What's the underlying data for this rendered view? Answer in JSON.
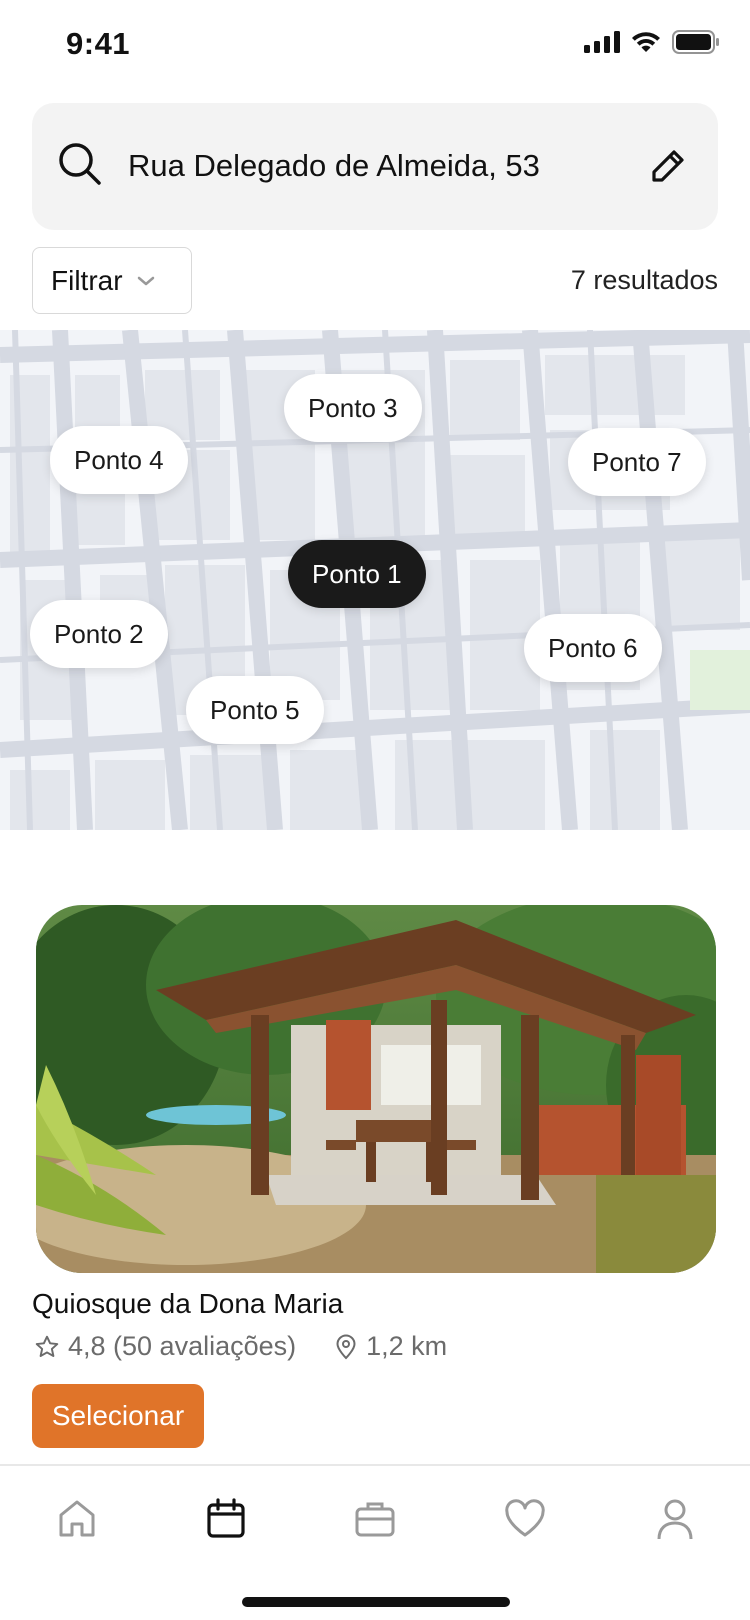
{
  "status_bar": {
    "time": "9:41"
  },
  "search": {
    "address": "Rua Delegado de Almeida, 53"
  },
  "filter": {
    "label": "Filtrar",
    "results": "7 resultados"
  },
  "map": {
    "pins": [
      {
        "label": "Ponto 3"
      },
      {
        "label": "Ponto 4"
      },
      {
        "label": "Ponto 7"
      },
      {
        "label": "Ponto 1",
        "active": true
      },
      {
        "label": "Ponto 2"
      },
      {
        "label": "Ponto 6"
      },
      {
        "label": "Ponto 5"
      }
    ]
  },
  "listing": {
    "title": "Quiosque da Dona Maria",
    "rating": "4,8 (50 avaliações)",
    "distance": "1,2 km",
    "select_label": "Selecionar"
  },
  "tab_bar": {
    "tabs": [
      {
        "icon": "home-icon"
      },
      {
        "icon": "calendar-icon",
        "active": true
      },
      {
        "icon": "briefcase-icon"
      },
      {
        "icon": "heart-icon"
      },
      {
        "icon": "user-icon"
      }
    ]
  },
  "colors": {
    "accent": "#e07429",
    "active_pin": "#1a1a1a",
    "map_road": "#d5d9e2"
  }
}
